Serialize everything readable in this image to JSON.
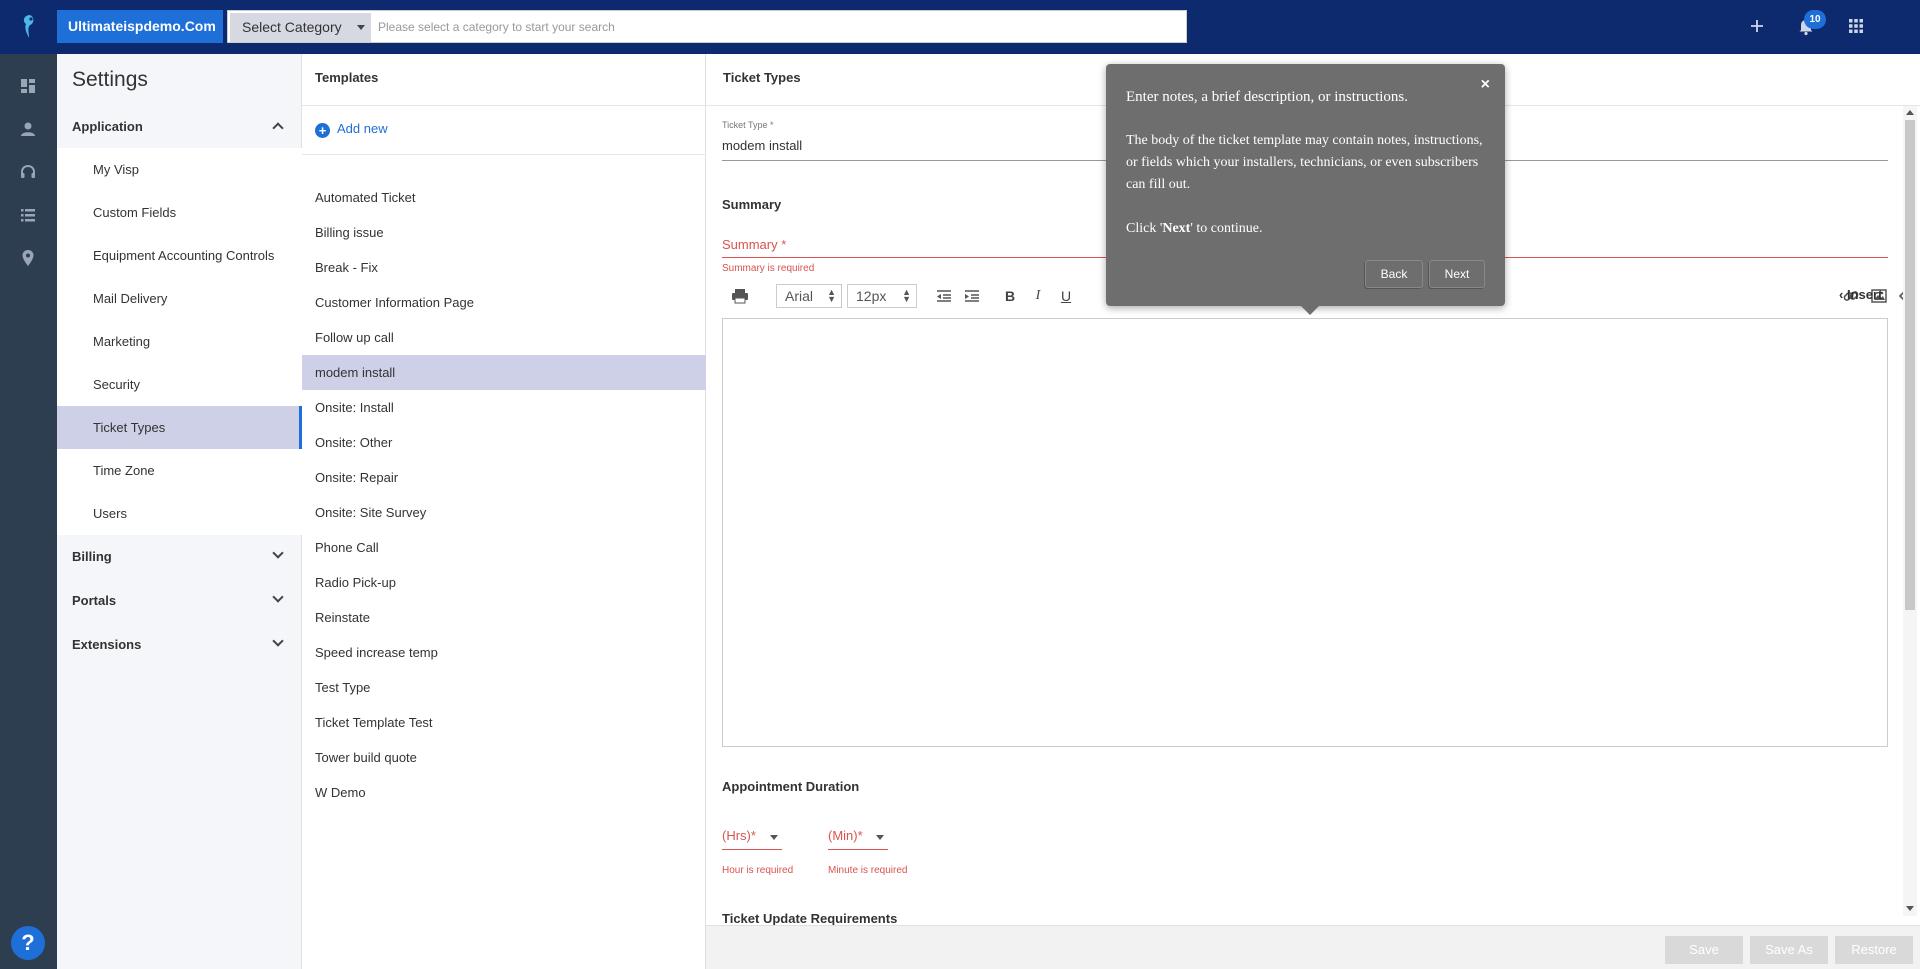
{
  "topbar": {
    "brand": "Ultimateispdemo.Com",
    "select_category": "Select Category",
    "search_placeholder": "Please select a category to start your search",
    "notification_count": "10"
  },
  "rail": {
    "icons": [
      "dashboard-icon",
      "user-icon",
      "headset-icon",
      "list-icon",
      "location-pin-icon"
    ],
    "help": "?"
  },
  "settings": {
    "title": "Settings",
    "sections": [
      {
        "label": "Application",
        "expanded": true
      },
      {
        "label": "Billing",
        "expanded": false
      },
      {
        "label": "Portals",
        "expanded": false
      },
      {
        "label": "Extensions",
        "expanded": false
      }
    ],
    "application_items": [
      "My Visp",
      "Custom Fields",
      "Equipment Accounting Controls",
      "Mail Delivery",
      "Marketing",
      "Security",
      "Ticket Types",
      "Time Zone",
      "Users"
    ],
    "active_item": "Ticket Types"
  },
  "templates": {
    "title": "Templates",
    "add_new": "Add new",
    "items": [
      "Automated Ticket",
      "Billing issue",
      "Break - Fix",
      "Customer Information Page",
      "Follow up call",
      "modem install",
      "Onsite: Install",
      "Onsite: Other",
      "Onsite: Repair",
      "Onsite: Site Survey",
      "Phone Call",
      "Radio Pick-up",
      "Reinstate",
      "Speed increase temp",
      "Test Type",
      "Ticket Template Test",
      "Tower build quote",
      "W Demo"
    ],
    "active": "modem install"
  },
  "form": {
    "title": "Ticket Types",
    "ticket_type_label": "Ticket Type *",
    "ticket_type_value": "modem install",
    "summary_section": "Summary",
    "summary_label": "Summary *",
    "summary_error": "Summary is required",
    "toolbar": {
      "font": "Arial",
      "size": "12px",
      "insert": "Insert"
    },
    "appointment_title": "Appointment Duration",
    "hrs_label": "(Hrs)*",
    "hrs_error": "Hour is required",
    "min_label": "(Min)*",
    "min_error": "Minute is required",
    "update_title": "Ticket Update Requirements",
    "footer": {
      "save": "Save",
      "save_as": "Save As",
      "restore": "Restore"
    }
  },
  "tour": {
    "close": "×",
    "title": "Enter notes, a brief description, or instructions.",
    "body": "The body of the ticket template may contain notes, instructions, or fields which your installers, technicians, or even subscribers can fill out.",
    "continue_prefix": "Click '",
    "continue_bold": "Next",
    "continue_suffix": "' to continue.",
    "back": "Back",
    "next": "Next"
  }
}
